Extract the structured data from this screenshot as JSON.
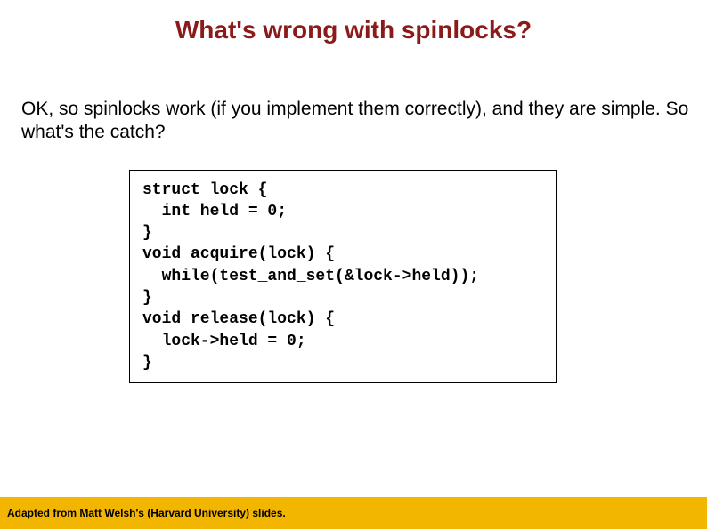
{
  "title": "What's wrong with spinlocks?",
  "body": "OK, so spinlocks work (if you implement them correctly), and they are simple. So what's the catch?",
  "code": "struct lock {\n  int held = 0;\n}\nvoid acquire(lock) {\n  while(test_and_set(&lock->held));\n}\nvoid release(lock) {\n  lock->held = 0;\n}",
  "footer": "Adapted from Matt Welsh's (Harvard University) slides."
}
